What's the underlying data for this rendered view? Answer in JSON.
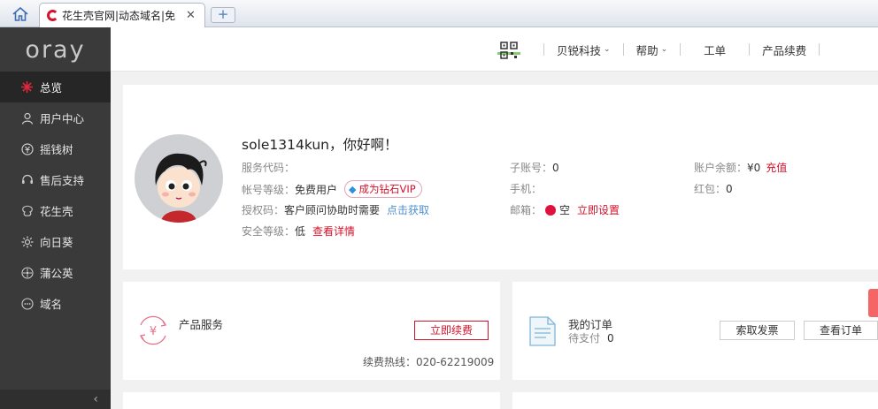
{
  "browser": {
    "tab_title": "花生壳官网|动态域名|免",
    "close_glyph": "✕",
    "newtab_glyph": "+"
  },
  "sidebar": {
    "logo": "oray",
    "items": [
      {
        "label": "总览",
        "icon": "overview-icon",
        "active": true
      },
      {
        "label": "用户中心",
        "icon": "user-icon"
      },
      {
        "label": "摇钱树",
        "icon": "money-tree-icon"
      },
      {
        "label": "售后支持",
        "icon": "support-icon"
      },
      {
        "label": "花生壳",
        "icon": "peanut-icon"
      },
      {
        "label": "向日葵",
        "icon": "sunflower-icon"
      },
      {
        "label": "蒲公英",
        "icon": "dandelion-icon"
      },
      {
        "label": "域名",
        "icon": "domain-icon"
      }
    ],
    "collapse_glyph": "‹"
  },
  "header": {
    "nav": [
      {
        "label": "贝锐科技",
        "caret": "⌄"
      },
      {
        "label": "帮助",
        "caret": "⌄"
      },
      {
        "label": "工单"
      },
      {
        "label": "产品续费"
      }
    ]
  },
  "profile": {
    "greeting": "sole1314kun，你好啊！",
    "service_code_label": "服务代码：",
    "account_level_label": "帐号等级：",
    "account_level_value": "免费用户",
    "vip_link": "成为钻石VIP",
    "auth_code_label": "授权码：",
    "auth_code_value": "客户顾问协助时需要",
    "auth_code_link": "点击获取",
    "security_label": "安全等级：",
    "security_value": "低",
    "security_link": "查看详情",
    "sub_account_label": "子账号：",
    "sub_account_value": "0",
    "phone_label": "手机：",
    "email_label": "邮箱：",
    "email_value": "空",
    "email_link": "立即设置",
    "balance_label": "账户余额：",
    "balance_value": "¥0",
    "balance_link": "充值",
    "redpacket_label": "红包：",
    "redpacket_value": "0"
  },
  "product_card": {
    "title": "产品服务",
    "icon_glyph": "¥",
    "renew_button": "立即续费",
    "hotline": "续费热线：020-62219009"
  },
  "order_card": {
    "title": "我的订单",
    "pending_label": "待支付",
    "pending_value": "0",
    "invoice_button": "索取发票",
    "view_button": "查看订单"
  },
  "colors": {
    "brand_red": "#d6112b",
    "sidebar_bg": "#3a3a3a",
    "link_blue": "#4e8fcc"
  }
}
